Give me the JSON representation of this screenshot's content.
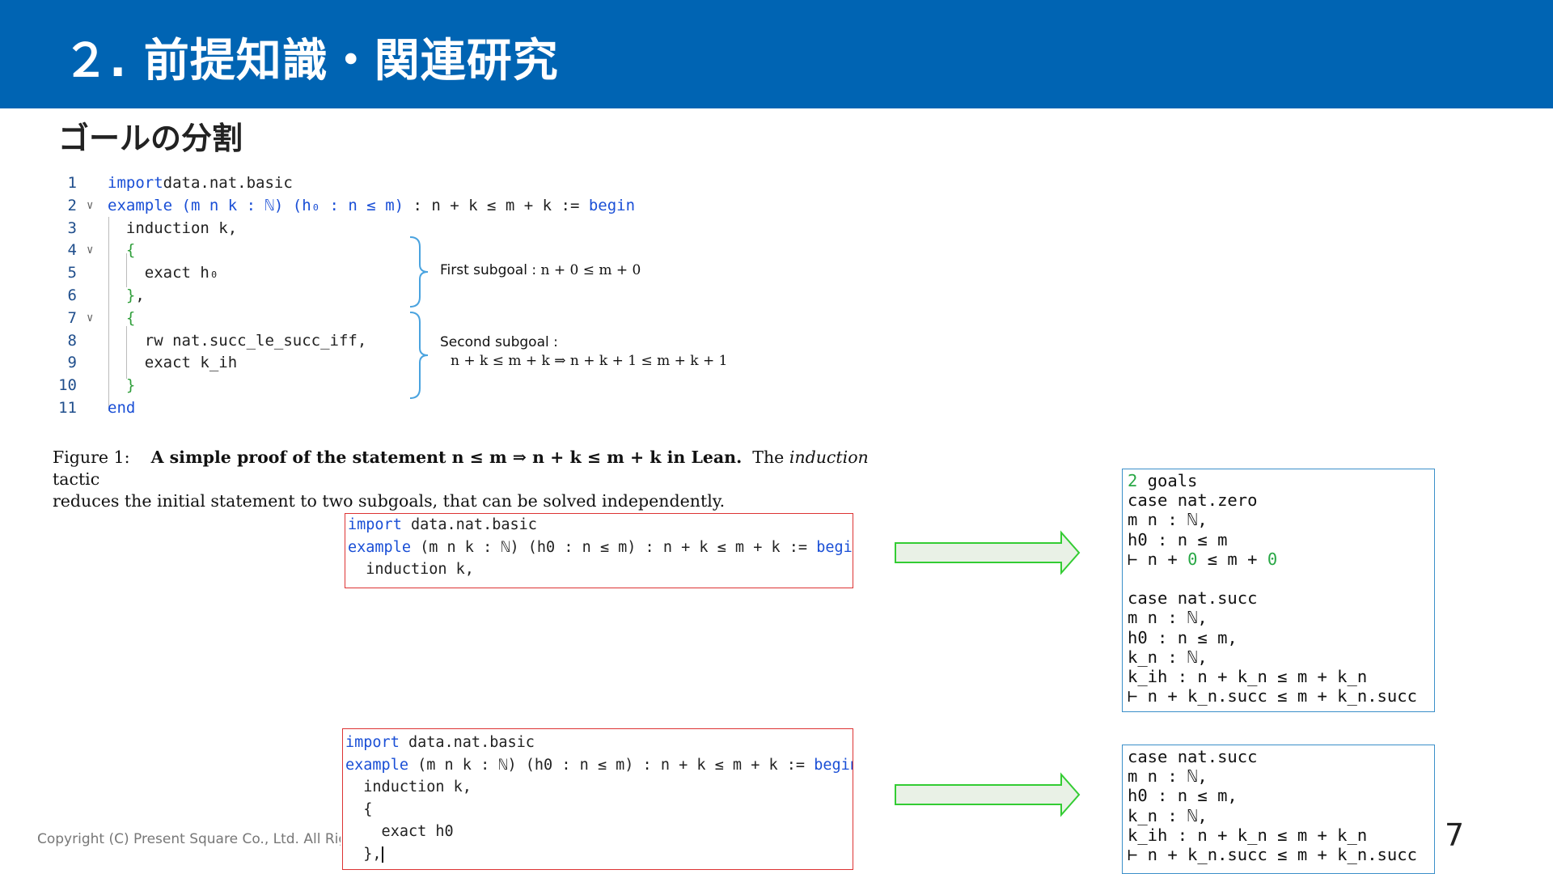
{
  "header": {
    "title": "２. 前提知識・関連研究"
  },
  "subtitle": "ゴールの分割",
  "figure": {
    "lines": [
      {
        "n": "1",
        "fold": "",
        "parts": [
          [
            "kw",
            "import"
          ],
          [
            "",
            "data.nat.basic"
          ]
        ]
      },
      {
        "n": "2",
        "fold": "∨",
        "parts": [
          [
            "kw",
            "example"
          ],
          [
            "kw",
            " (m n k : ℕ)"
          ],
          [
            "kw",
            " (h₀ : n ≤ m)"
          ],
          [
            "",
            " : n + k ≤ m + k := "
          ],
          [
            "kw",
            "begin"
          ]
        ]
      },
      {
        "n": "3",
        "fold": "",
        "parts": [
          [
            "",
            "  induction k,"
          ]
        ]
      },
      {
        "n": "4",
        "fold": "∨",
        "parts": [
          [
            "gr",
            "  {"
          ]
        ]
      },
      {
        "n": "5",
        "fold": "",
        "parts": [
          [
            "",
            "    exact h₀"
          ]
        ]
      },
      {
        "n": "6",
        "fold": "",
        "parts": [
          [
            "gr",
            "  }"
          ],
          [
            "",
            ","
          ]
        ]
      },
      {
        "n": "7",
        "fold": "∨",
        "parts": [
          [
            "gr",
            "  {"
          ]
        ]
      },
      {
        "n": "8",
        "fold": "",
        "parts": [
          [
            "",
            "    rw nat.succ_le_succ_iff,"
          ]
        ]
      },
      {
        "n": "9",
        "fold": "",
        "parts": [
          [
            "",
            "    exact k_ih"
          ]
        ]
      },
      {
        "n": "10",
        "fold": "",
        "parts": [
          [
            "gr",
            "  }"
          ]
        ]
      },
      {
        "n": "11",
        "fold": "",
        "parts": [
          [
            "kw",
            "end"
          ]
        ]
      }
    ],
    "first_subgoal_label": "First subgoal :",
    "first_subgoal_math": "n + 0 ≤ m + 0",
    "second_subgoal_label": "Second subgoal :",
    "second_subgoal_math": "n + k ≤ m + k ⇒ n + k + 1 ≤ m + k + 1",
    "caption_prefix": "Figure 1:",
    "caption_bold": "A simple proof of the statement n ≤ m ⇒ n + k ≤ m + k in Lean.",
    "caption_rest_1": "The",
    "caption_italic": "induction",
    "caption_rest_2": "tactic",
    "caption_line2": "reduces the initial statement to two subgoals, that can be solved independently."
  },
  "box1": {
    "rows": [
      [
        [
          "kw",
          "import"
        ],
        [
          "",
          " data.nat.basic"
        ]
      ],
      [
        [
          "kw",
          "example"
        ],
        [
          "",
          " (m n k : ℕ) (h0 : n ≤ m) : n + k ≤ m + k := "
        ],
        [
          "kw",
          "begin"
        ]
      ],
      [
        [
          "",
          "  induction k,"
        ]
      ]
    ]
  },
  "box2": {
    "rows": [
      [
        [
          "kw",
          "import"
        ],
        [
          "",
          " data.nat.basic"
        ]
      ],
      [
        [
          "kw",
          "example"
        ],
        [
          "",
          " (m n k : ℕ) (h0 : n ≤ m) : n + k ≤ m + k := "
        ],
        [
          "kw",
          "begin"
        ]
      ],
      [
        [
          "",
          "  induction k,"
        ]
      ],
      [
        [
          "",
          "  {"
        ]
      ],
      [
        [
          "",
          "    exact h0"
        ]
      ],
      [
        [
          "",
          "  },"
        ]
      ]
    ]
  },
  "goals1": {
    "rows": [
      [
        [
          "green",
          "2"
        ],
        [
          "",
          " goals"
        ]
      ],
      [
        [
          "",
          "case nat.zero"
        ]
      ],
      [
        [
          "",
          "m n : ℕ,"
        ]
      ],
      [
        [
          "",
          "h0 : n ≤ m"
        ]
      ],
      [
        [
          "",
          "⊢ n + "
        ],
        [
          "green",
          "0"
        ],
        [
          "",
          " ≤ m + "
        ],
        [
          "green",
          "0"
        ]
      ],
      [
        [
          "",
          ""
        ]
      ],
      [
        [
          "",
          "case nat.succ"
        ]
      ],
      [
        [
          "",
          "m n : ℕ,"
        ]
      ],
      [
        [
          "",
          "h0 : n ≤ m,"
        ]
      ],
      [
        [
          "",
          "k_n : ℕ,"
        ]
      ],
      [
        [
          "",
          "k_ih : n + k_n ≤ m + k_n"
        ]
      ],
      [
        [
          "",
          "⊢ n + k_n.succ ≤ m + k_n.succ"
        ]
      ]
    ]
  },
  "goals2": {
    "rows": [
      [
        [
          "",
          "case nat.succ"
        ]
      ],
      [
        [
          "",
          "m n : ℕ,"
        ]
      ],
      [
        [
          "",
          "h0 : n ≤ m,"
        ]
      ],
      [
        [
          "",
          "k_n : ℕ,"
        ]
      ],
      [
        [
          "",
          "k_ih : n + k_n ≤ m + k_n"
        ]
      ],
      [
        [
          "",
          "⊢ n + k_n.succ ≤ m + k_n.succ"
        ]
      ]
    ]
  },
  "footer": {
    "copyright": "Copyright (C) Present Square Co., Ltd. All Rights Reserved."
  },
  "page_number": "7",
  "colors": {
    "header": "#0064b3",
    "keyword": "#1a4fd6",
    "brace_green": "#2f9e3a",
    "box_red": "#d33333",
    "box_blue": "#3b8fc9",
    "arrow_green": "#33cc33",
    "arrow_fill": "#e9f1e6"
  }
}
